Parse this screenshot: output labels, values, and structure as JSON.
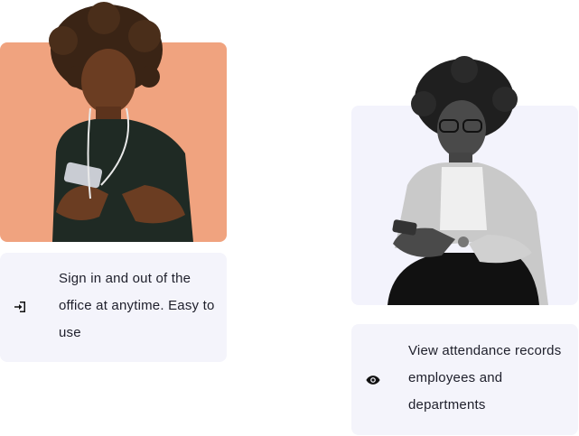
{
  "features": [
    {
      "icon": "sign-in-icon",
      "text": "Sign in and out of the office at anytime. Easy to use",
      "background": "#f0a37f"
    },
    {
      "icon": "eye-icon",
      "text": "View attendance records employees and departments",
      "background": "#f3f3fc"
    }
  ]
}
